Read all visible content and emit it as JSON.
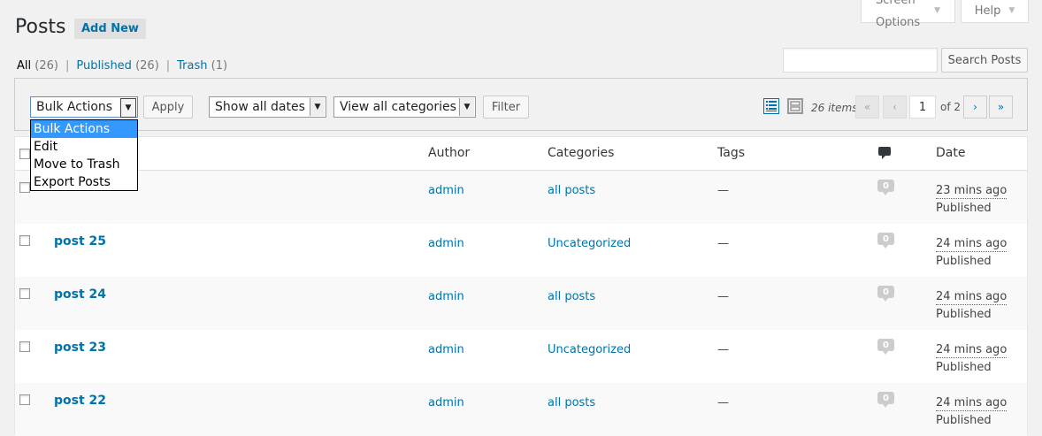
{
  "header": {
    "title": "Posts",
    "add_new": "Add New",
    "screen_options": "Screen Options",
    "help": "Help"
  },
  "filters": {
    "all_label": "All",
    "all_count": "(26)",
    "published_label": "Published",
    "published_count": "(26)",
    "trash_label": "Trash",
    "trash_count": "(1)",
    "separator": "|"
  },
  "search": {
    "value": "",
    "button": "Search Posts"
  },
  "tablenav": {
    "bulk_actions": "Bulk Actions",
    "apply": "Apply",
    "dates": "Show all dates",
    "categories": "View all categories",
    "filter": "Filter",
    "items": "26 items",
    "first": "«",
    "prev": "‹",
    "current_page": "1",
    "of_pages": "of 2",
    "next": "›",
    "last": "»"
  },
  "bulk_dropdown": {
    "options": [
      "Bulk Actions",
      "Edit",
      "Move to Trash",
      "Export Posts"
    ],
    "selected_index": 0
  },
  "columns": {
    "author": "Author",
    "categories": "Categories",
    "tags": "Tags",
    "date": "Date"
  },
  "rows": [
    {
      "title": "",
      "author": "admin",
      "category": "all posts",
      "tags": "—",
      "comments": "0",
      "date": "23 mins ago",
      "status": "Published"
    },
    {
      "title": "post 25",
      "author": "admin",
      "category": "Uncategorized",
      "tags": "—",
      "comments": "0",
      "date": "24 mins ago",
      "status": "Published"
    },
    {
      "title": "post 24",
      "author": "admin",
      "category": "all posts",
      "tags": "—",
      "comments": "0",
      "date": "24 mins ago",
      "status": "Published"
    },
    {
      "title": "post 23",
      "author": "admin",
      "category": "Uncategorized",
      "tags": "—",
      "comments": "0",
      "date": "24 mins ago",
      "status": "Published"
    },
    {
      "title": "post 22",
      "author": "admin",
      "category": "all posts",
      "tags": "—",
      "comments": "0",
      "date": "24 mins ago",
      "status": "Published"
    }
  ],
  "colors": {
    "link": "#0073aa",
    "background": "#f1f1f1",
    "selected_option": "#3399ff"
  }
}
